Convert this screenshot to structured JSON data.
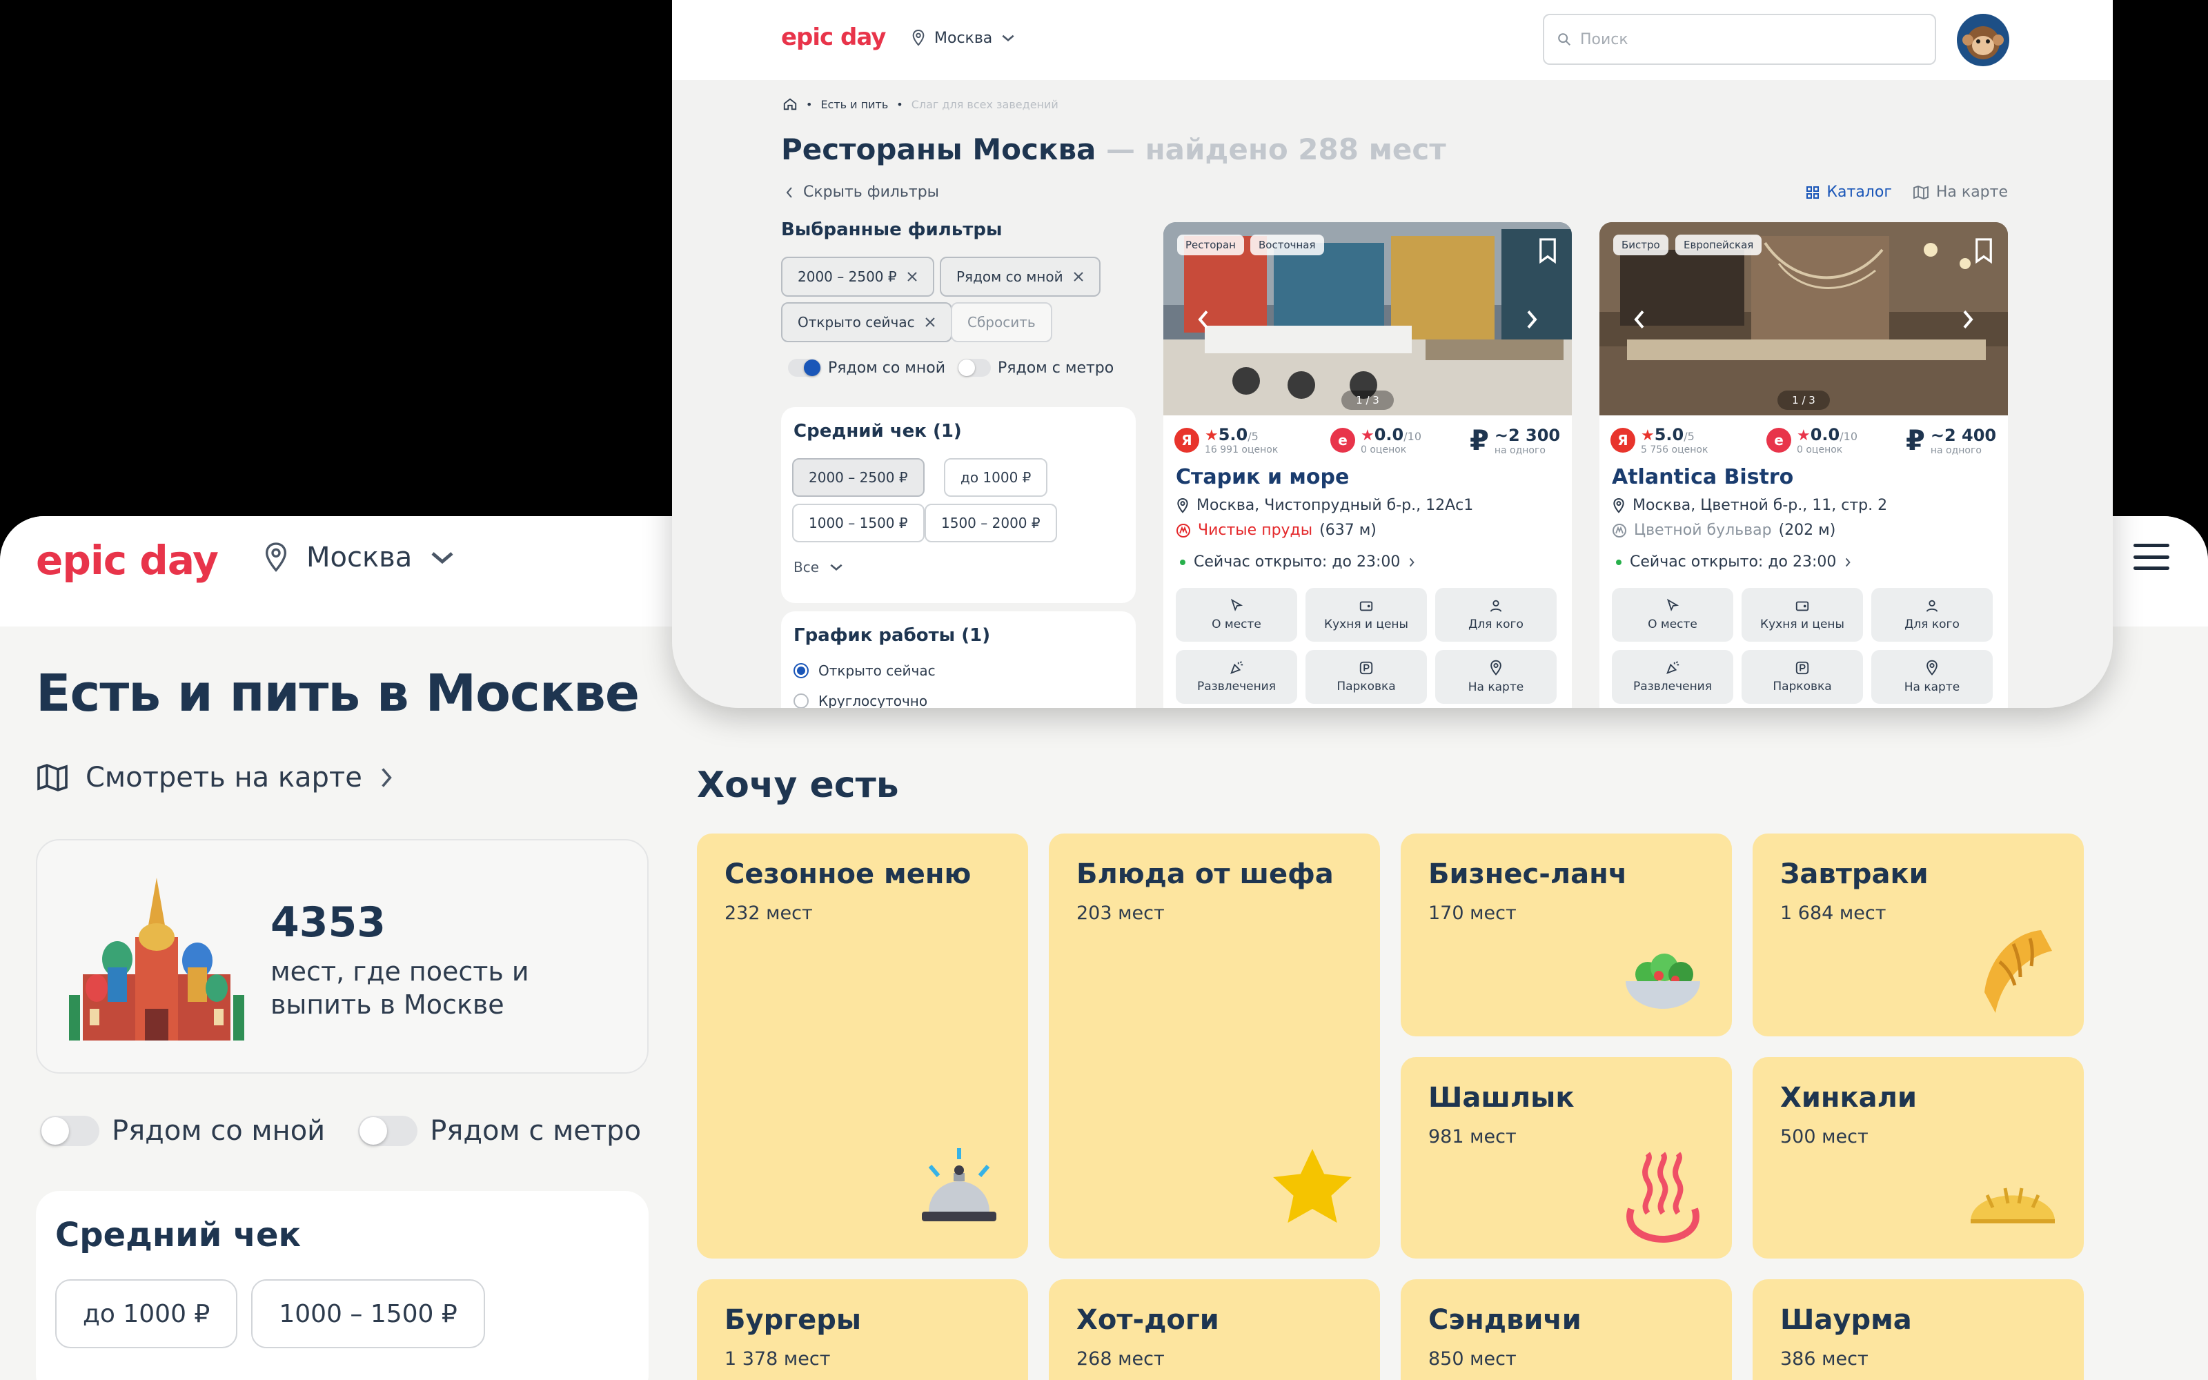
{
  "back": {
    "logo": "epic day",
    "city": "Москва",
    "page_title": "Есть и пить в Москве",
    "map_link": "Смотреть на карте",
    "stat_number": "4353",
    "stat_desc": "мест, где поесть и выпить в Москве",
    "toggle_near_me": "Рядом со мной",
    "toggle_near_metro": "Рядом с метро",
    "avg_check_title": "Средний чек",
    "check_chips": [
      "до 1000 ₽",
      "1000 – 1500 ₽"
    ],
    "section_title": "Хочу есть",
    "tiles": [
      {
        "name": "Сезонное меню",
        "count": "232 мест",
        "icon": "bell-icon"
      },
      {
        "name": "Блюда от шефа",
        "count": "203 мест",
        "icon": "star-icon"
      },
      {
        "name": "Бизнес-ланч",
        "count": "170 мест",
        "icon": "salad-icon"
      },
      {
        "name": "Завтраки",
        "count": "1 684 мест",
        "icon": "croissant-icon"
      },
      {
        "name": "Шашлык",
        "count": "981 мест",
        "icon": "hot-springs-icon"
      },
      {
        "name": "Хинкали",
        "count": "500 мест",
        "icon": "dumpling-icon"
      },
      {
        "name": "Бургеры",
        "count": "1 378 мест"
      },
      {
        "name": "Хот-доги",
        "count": "268 мест"
      },
      {
        "name": "Сэндвичи",
        "count": "850 мест"
      },
      {
        "name": "Шаурма",
        "count": "386 мест"
      }
    ]
  },
  "front": {
    "logo": "epic day",
    "city": "Москва",
    "search_placeholder": "Поиск",
    "breadcrumb": [
      "Есть и пить",
      "Слаг для всех заведений"
    ],
    "title": "Рестораны Москва",
    "title_found": "— найдено 288 мест",
    "hide_filters": "Скрыть фильтры",
    "view_catalog": "Каталог",
    "view_map": "На карте",
    "selected_filters_title": "Выбранные фильтры",
    "selected_filters": [
      "2000 – 2500 ₽",
      "Рядом со мной",
      "Открыто сейчас"
    ],
    "reset": "Сбросить",
    "toggle_near_me": "Рядом со мной",
    "toggle_near_metro": "Рядом с метро",
    "avg_check": {
      "title": "Средний чек (1)",
      "options": [
        "2000 – 2500 ₽",
        "до 1000 ₽",
        "1000 – 1500 ₽",
        "1500 – 2000 ₽"
      ],
      "more": "Все"
    },
    "schedule": {
      "title": "График работы (1)",
      "options": [
        "Открыто сейчас",
        "Круглосуточно"
      ]
    },
    "cards": [
      {
        "tags": [
          "Ресторан",
          "Восточная"
        ],
        "photo_counter": "1 / 3",
        "yandex_rating": "5.0",
        "yandex_scale": "/5",
        "yandex_reviews": "16 991 оценок",
        "epic_rating": "0.0",
        "epic_scale": "/10",
        "epic_reviews": "0 оценок",
        "price": "~2 300",
        "price_sub": "на одного",
        "name": "Старик и море",
        "address": "Москва, Чистопрудный б-р., 12Ас1",
        "metro": "Чистые пруды",
        "metro_dist": "(637 м)",
        "metro_color": "#e4282b",
        "open": "Сейчас открыто: до 23:00"
      },
      {
        "tags": [
          "Бистро",
          "Европейская"
        ],
        "photo_counter": "1 / 3",
        "yandex_rating": "5.0",
        "yandex_scale": "/5",
        "yandex_reviews": "5 756 оценок",
        "epic_rating": "0.0",
        "epic_scale": "/10",
        "epic_reviews": "0 оценок",
        "price": "~2 400",
        "price_sub": "на одного",
        "name": "Atlantica Bistro",
        "address": "Москва, Цветной б-р., 11, стр. 2",
        "metro": "Цветной бульвар",
        "metro_dist": "(202 м)",
        "metro_color": "#8a939d",
        "open": "Сейчас открыто: до 23:00"
      }
    ],
    "actions": [
      "О месте",
      "Кухня и цены",
      "Для кого",
      "Развлечения",
      "Парковка",
      "На карте"
    ]
  }
}
